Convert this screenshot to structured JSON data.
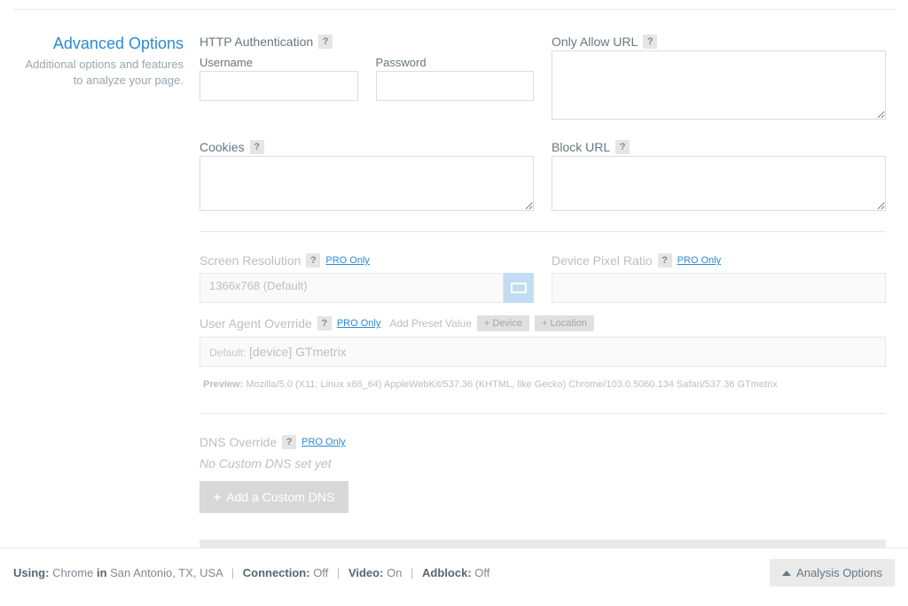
{
  "sidebar": {
    "title": "Advanced Options",
    "desc": "Additional options and features to analyze your page."
  },
  "httpAuth": {
    "label": "HTTP Authentication",
    "usernameLabel": "Username",
    "passwordLabel": "Password"
  },
  "onlyAllow": {
    "label": "Only Allow URL"
  },
  "cookies": {
    "label": "Cookies"
  },
  "blockUrl": {
    "label": "Block URL"
  },
  "screenRes": {
    "label": "Screen Resolution",
    "pro": "PRO Only",
    "value": "1366x768 (Default)"
  },
  "dpr": {
    "label": "Device Pixel Ratio",
    "pro": "PRO Only"
  },
  "userAgent": {
    "label": "User Agent Override",
    "pro": "PRO Only",
    "addPreset": "Add Preset Value",
    "btnDevice": "+ Device",
    "btnLocation": "+ Location",
    "default": "Default:",
    "device": "[device] GTmetrix",
    "previewLabel": "Preview:",
    "preview": "Mozilla/5.0 (X11; Linux x86_64) AppleWebKit/537.36 (KHTML, like Gecko) Chrome/103.0.5060.134 Safari/537.36 GTmetrix"
  },
  "dns": {
    "label": "DNS Override",
    "pro": "PRO Only",
    "empty": "No Custom DNS set yet",
    "addBtn": "Add a Custom DNS"
  },
  "advToggle": "Advanced Options",
  "footer": {
    "usingLabel": "Using:",
    "browser": "Chrome",
    "inLabel": "in",
    "location": "San Antonio, TX, USA",
    "connLabel": "Connection:",
    "conn": "Off",
    "videoLabel": "Video:",
    "video": "On",
    "adblockLabel": "Adblock:",
    "adblock": "Off",
    "analysisBtn": "Analysis Options"
  },
  "help": "?"
}
